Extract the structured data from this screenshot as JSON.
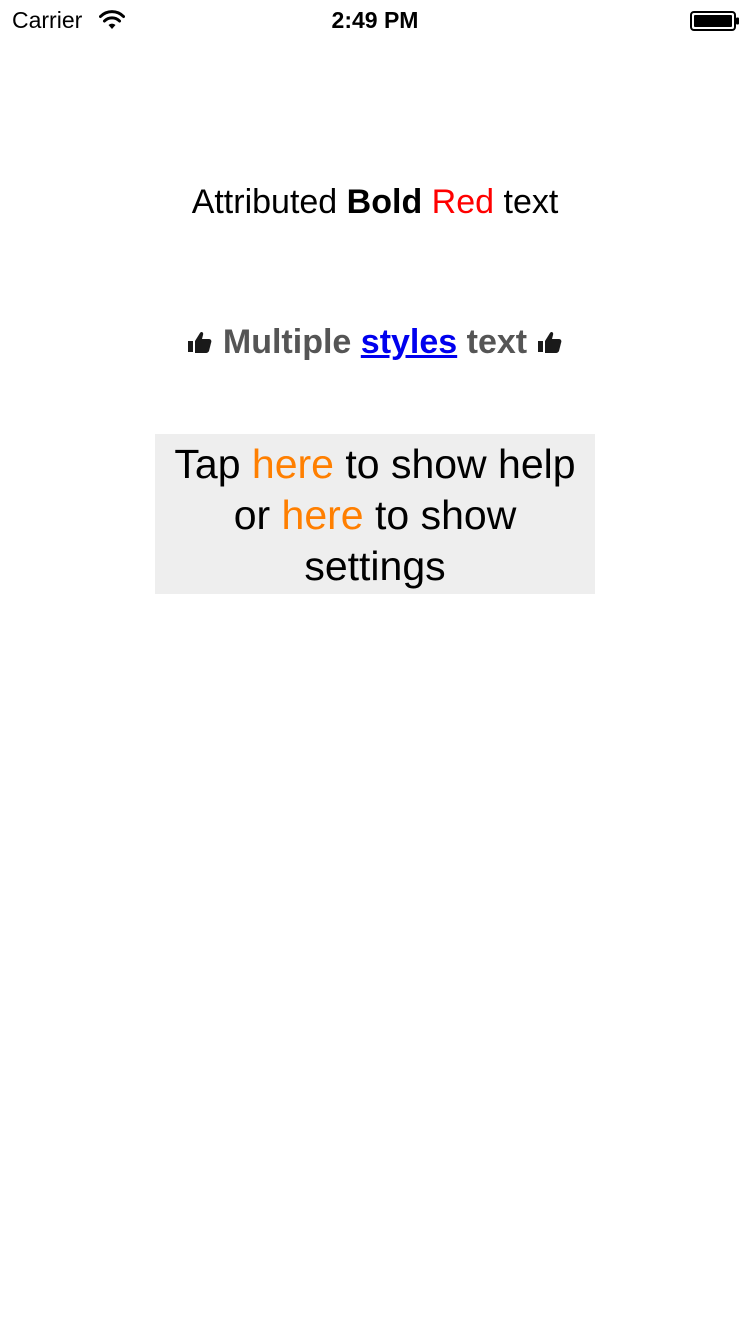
{
  "status_bar": {
    "carrier": "Carrier",
    "time": "2:49 PM",
    "wifi_icon": "wifi-icon",
    "battery_icon": "battery-icon"
  },
  "attributed_line": {
    "part1": "Attributed ",
    "bold": "Bold",
    "space1": " ",
    "red": "Red",
    "part2": " text",
    "red_color": "#ff0000"
  },
  "multiple_styles_line": {
    "leading_icon": "thumbs-up-icon",
    "part1": "Multiple ",
    "link": "styles",
    "part2": " text",
    "trailing_icon": "thumbs-up-icon",
    "text_color": "#555555",
    "link_color": "#0000ee"
  },
  "tap_box": {
    "part1": "Tap ",
    "link1": "here",
    "part2": " to show help",
    "part3": "or ",
    "link2": "here",
    "part4": " to show",
    "part5": "settings",
    "link_color": "#ff7f00",
    "background": "#eeeeee"
  }
}
